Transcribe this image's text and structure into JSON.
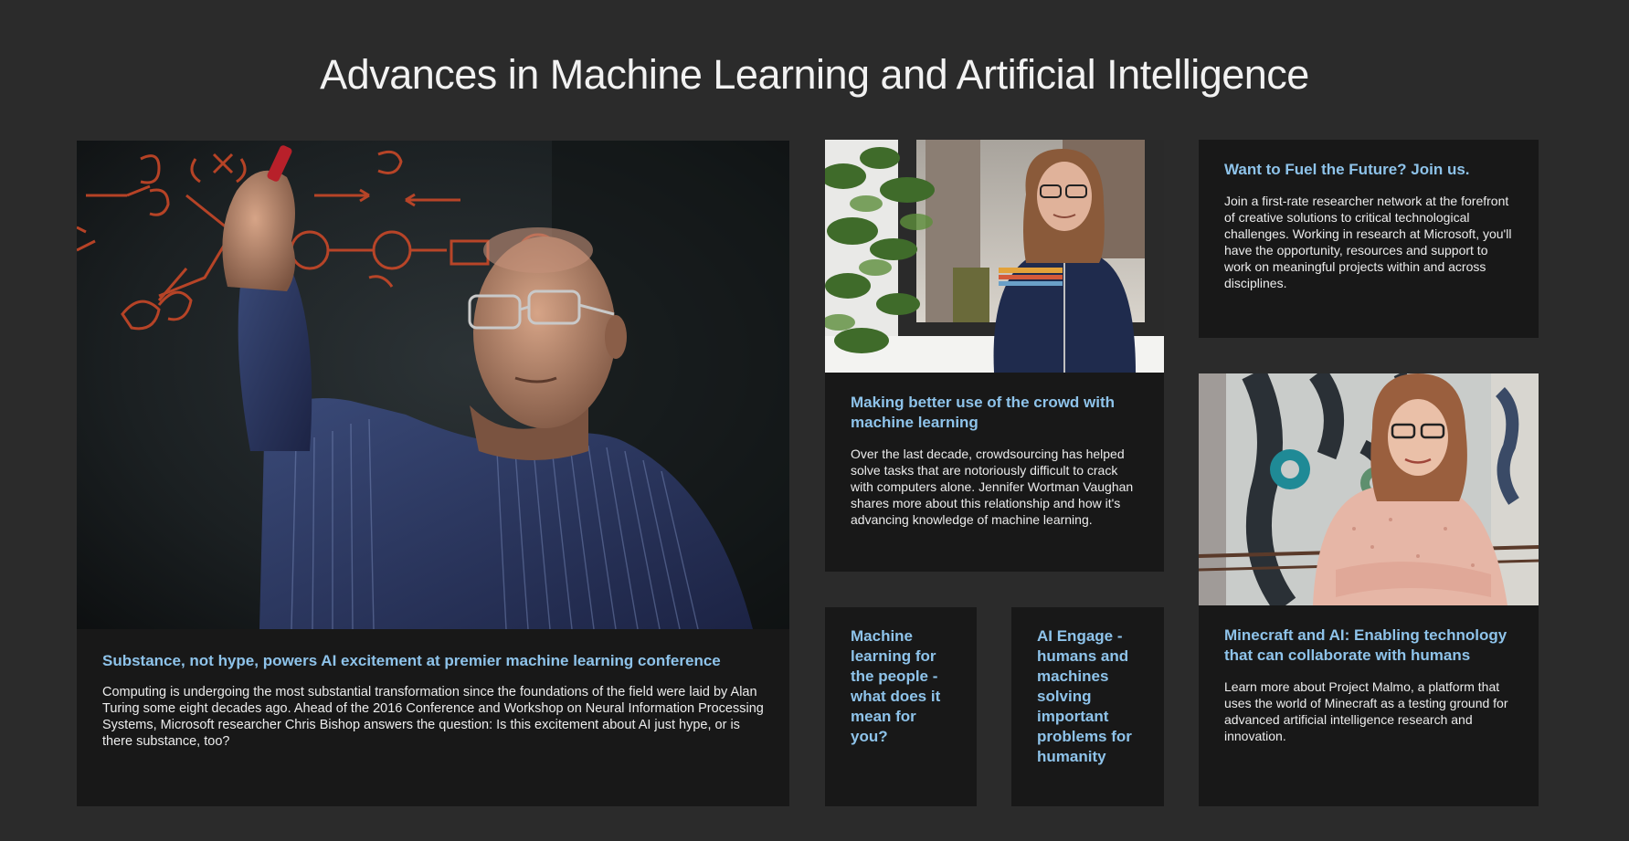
{
  "page": {
    "title": "Advances in Machine Learning and Artificial Intelligence"
  },
  "cards": {
    "hero": {
      "title": "Substance, not hype, powers AI excitement at premier machine learning conference",
      "text": "Computing is undergoing the most substantial transformation since the foundations of the field were laid by Alan Turing some eight decades ago. Ahead of the 2016 Conference and Workshop on Neural Information Processing Systems, Microsoft researcher Chris Bishop answers the question: Is this excitement about AI just hype, or is there substance, too?",
      "image_icon": "person-whiteboard-photo"
    },
    "crowd": {
      "title": "Making better use of the crowd with machine learning",
      "text": "Over the last decade, crowdsourcing has helped solve tasks that are notoriously difficult to crack with computers alone. Jennifer Wortman Vaughan shares more about this relationship and how it's advancing knowledge of machine learning.",
      "image_icon": "researcher-portrait-photo"
    },
    "join": {
      "title": "Want to Fuel the Future? Join us.",
      "text": "Join a first-rate researcher network at the forefront of creative solutions to critical technological challenges. Working in research at Microsoft, you'll have the opportunity, resources and support to work on meaningful projects within and across disciplines."
    },
    "minecraft": {
      "title": "Minecraft and AI: Enabling technology that can collaborate with humans",
      "text": "Learn more about Project Malmo, a platform that uses the world of Minecraft as a testing ground for advanced artificial intelligence research and innovation.",
      "image_icon": "researcher-portrait-photo"
    },
    "ml_people": {
      "title": "Machine learning for the people - what does it mean for you?"
    },
    "ai_engage": {
      "title": "AI Engage - humans and machines solving important problems for humanity"
    }
  },
  "colors": {
    "background": "#2b2b2b",
    "card": "#181818",
    "link": "#8ec3ea",
    "text": "#ececec"
  }
}
